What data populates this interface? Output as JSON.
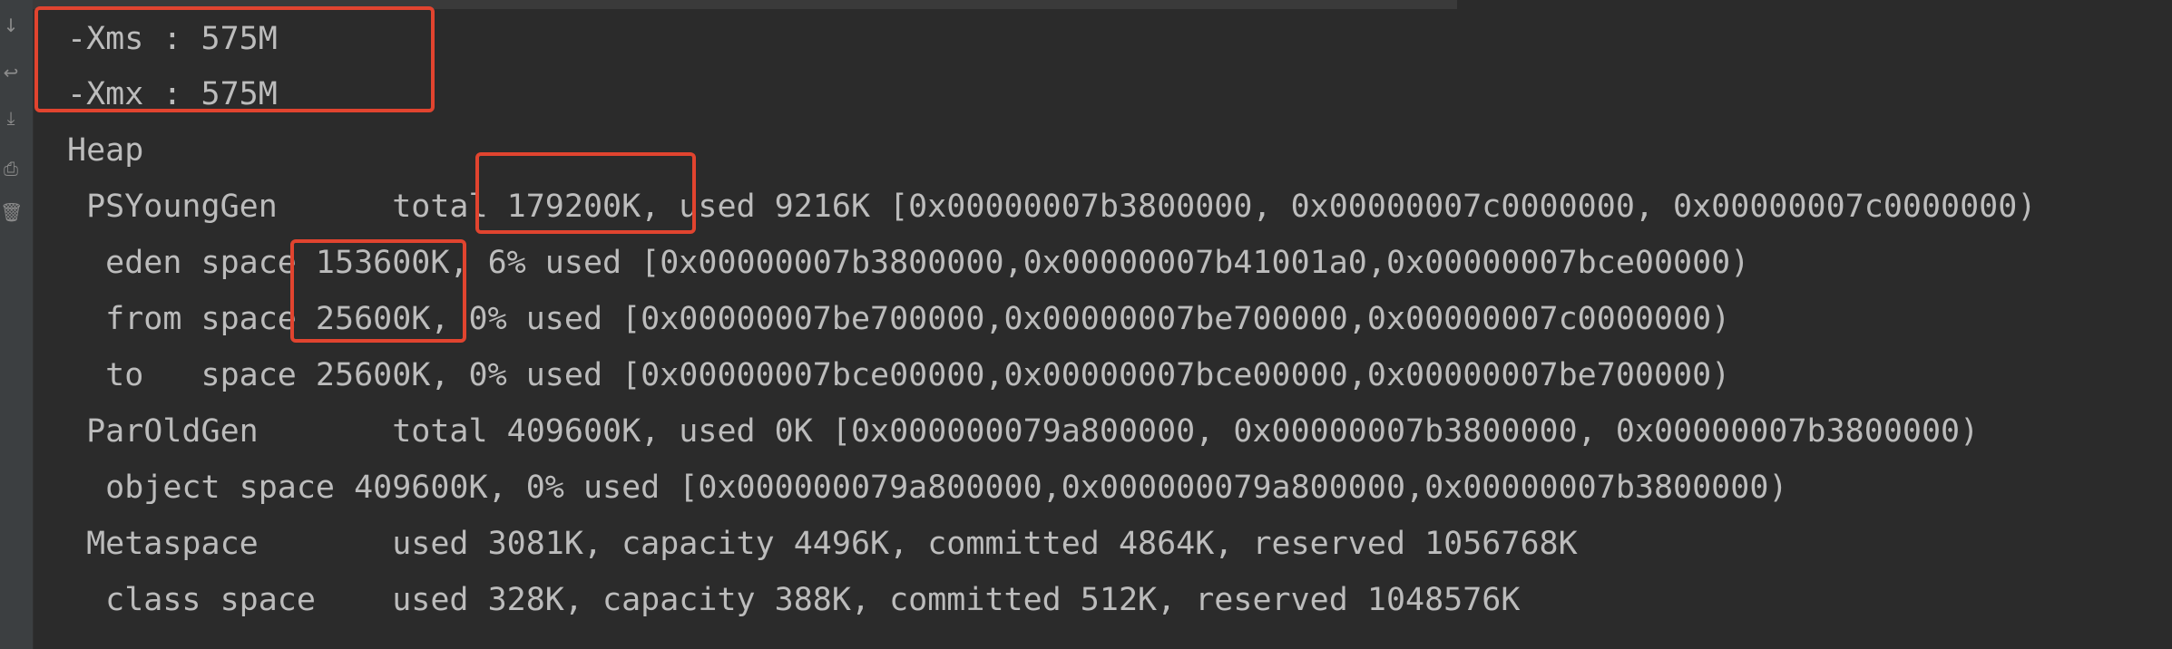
{
  "gutter": {
    "icons": [
      "arrow-down-icon",
      "soft-wrap-icon",
      "scroll-to-end-icon",
      "print-icon",
      "trash-icon"
    ],
    "glyphs": [
      "↓",
      "↩",
      "⤓",
      "⎙",
      "🗑"
    ]
  },
  "colors": {
    "background": "#2b2b2b",
    "text": "#bcbcbc",
    "highlight": "#e1442f",
    "gutter": "#3c3f41"
  },
  "console": {
    "lines": [
      "-Xms : 575M",
      "-Xmx : 575M",
      "Heap",
      " PSYoungGen      total 179200K, used 9216K [0x00000007b3800000, 0x00000007c0000000, 0x00000007c0000000)",
      "  eden space 153600K, 6% used [0x00000007b3800000,0x00000007b41001a0,0x00000007bce00000)",
      "  from space 25600K, 0% used [0x00000007be700000,0x00000007be700000,0x00000007c0000000)",
      "  to   space 25600K, 0% used [0x00000007bce00000,0x00000007bce00000,0x00000007be700000)",
      " ParOldGen       total 409600K, used 0K [0x000000079a800000, 0x00000007b3800000, 0x00000007b3800000)",
      "  object space 409600K, 0% used [0x000000079a800000,0x000000079a800000,0x00000007b3800000)",
      " Metaspace       used 3081K, capacity 4496K, committed 4864K, reserved 1056768K",
      "  class space    used 328K, capacity 388K, committed 512K, reserved 1048576K"
    ]
  }
}
